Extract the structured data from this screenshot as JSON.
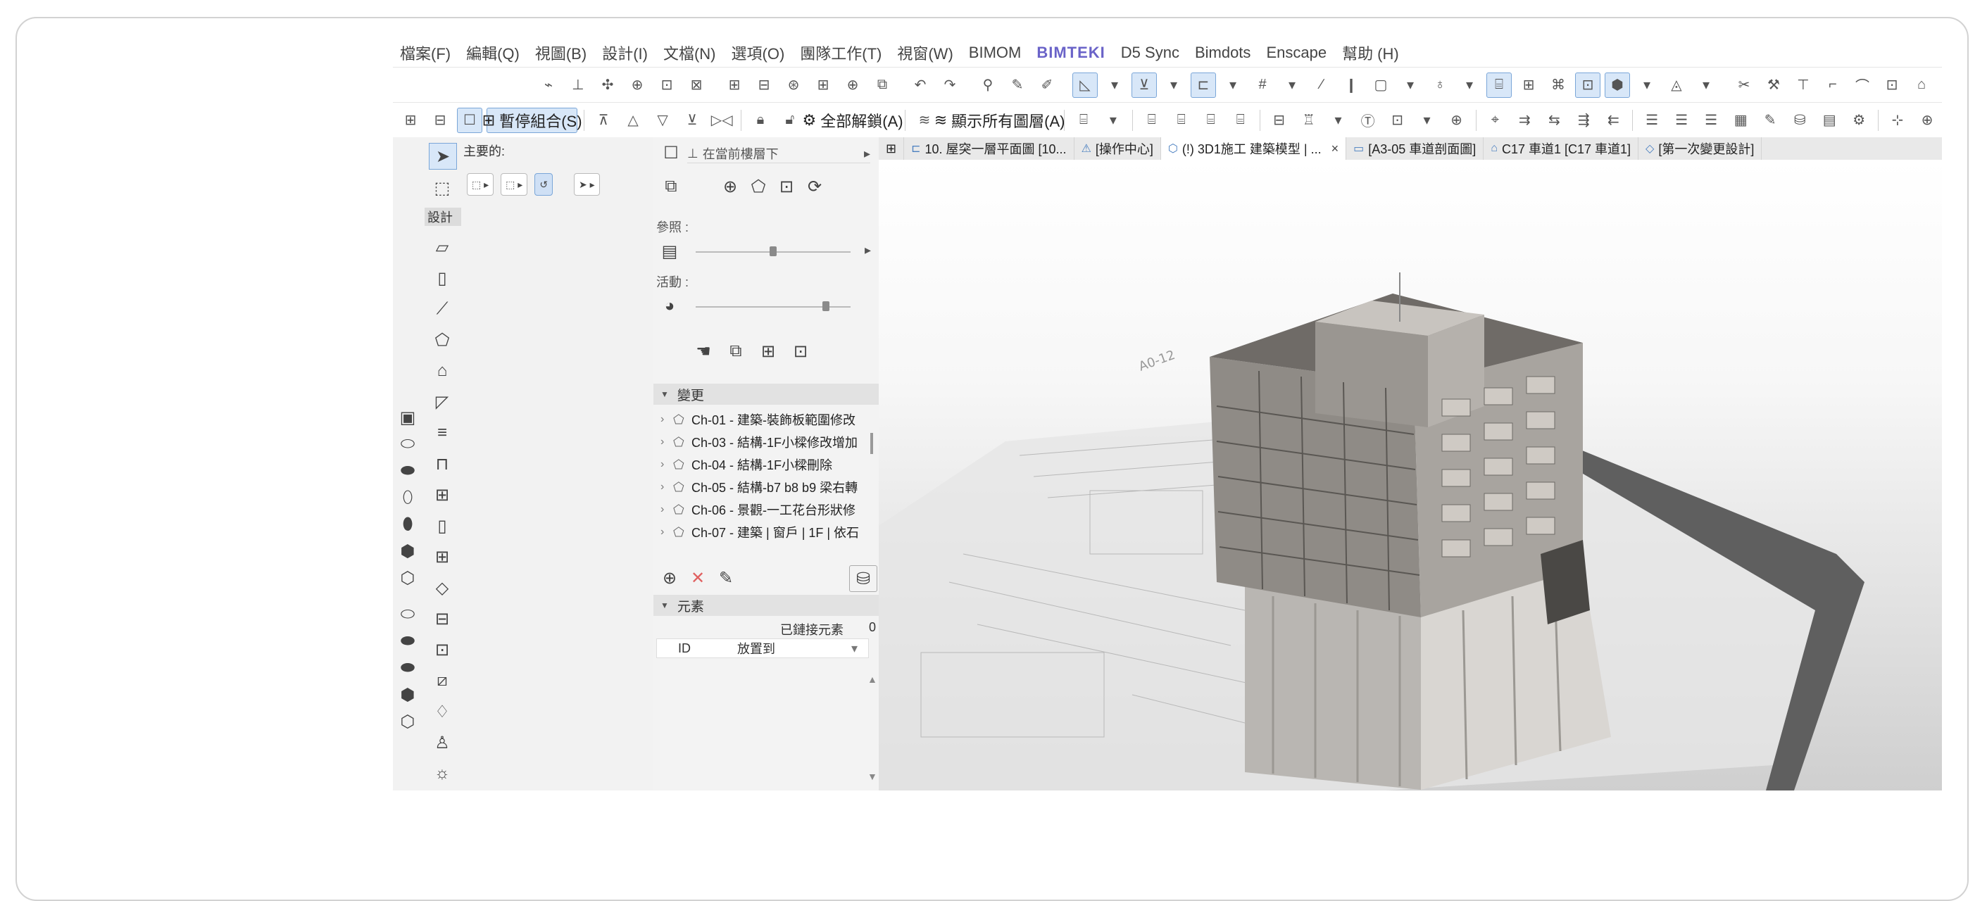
{
  "menu": [
    "檔案(F)",
    "編輯(Q)",
    "視圖(B)",
    "設計(I)",
    "文檔(N)",
    "選項(O)",
    "團隊工作(T)",
    "視窗(W)",
    "BIMOM",
    "BIMTEKI",
    "D5 Sync",
    "Bimdots",
    "Enscape",
    "幫助 (H)"
  ],
  "toolbar2": {
    "suspend_groups": "暫停組合(S)",
    "unlock_all": "全部解鎖(A)",
    "show_all_layers": "顯示所有圖層(A)"
  },
  "toolbox": {
    "main_label": "主要的:",
    "design_label": "設計"
  },
  "panel": {
    "story_dropdown": "在當前樓層下",
    "reference_label": "參照 :",
    "active_label": "活動 :",
    "changes_header": "變更",
    "changes": [
      "Ch-01 - 建築-裝飾板範圍修改",
      "Ch-03 - 結構-1F小樑修改增加",
      "Ch-04 - 結構-1F小樑刪除",
      "Ch-05 - 結構-b7 b8 b9 梁右轉",
      "Ch-06 - 景觀-一工花台形狀修",
      "Ch-07 - 建築 | 窗戶 | 1F | 依石"
    ],
    "elements_header": "元素",
    "linked_elements_label": "已鏈接元素",
    "linked_elements_count": "0",
    "col_id": "ID",
    "col_place": "放置到"
  },
  "tabs": [
    {
      "label": "10. 屋突一層平面圖 [10...",
      "active": false,
      "close": ""
    },
    {
      "label": "[操作中心]",
      "active": false,
      "close": ""
    },
    {
      "label": "(!) 3D1施工 建築模型 | ...",
      "active": true,
      "close": "×"
    },
    {
      "label": "[A3-05 車道剖面圖]",
      "active": false,
      "close": ""
    },
    {
      "label": "C17 車道1 [C17 車道1]",
      "active": false,
      "close": ""
    },
    {
      "label": "[第一次變更設計]",
      "active": false,
      "close": ""
    }
  ],
  "viewport": {
    "sheet_label": "A0-12"
  },
  "colors": {
    "brand": "#6a63c8",
    "toggle_on": "#d8e7f8",
    "building": "#8f8b86"
  }
}
